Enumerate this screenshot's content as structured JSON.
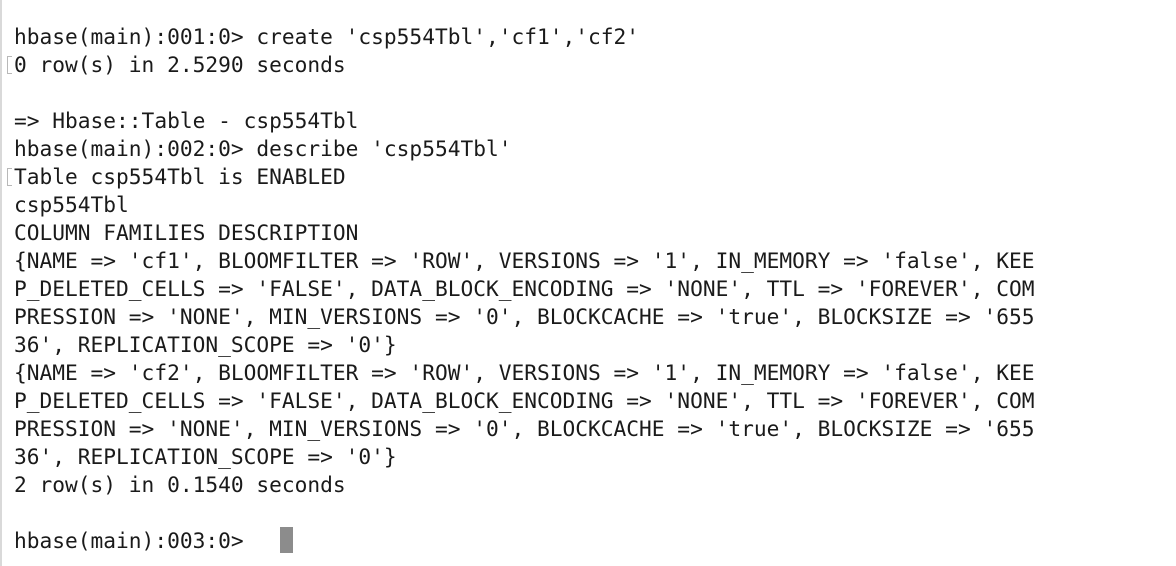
{
  "terminal": {
    "lines": [
      "hbase(main):001:0> create 'csp554Tbl','cf1','cf2'",
      "0 row(s) in 2.5290 seconds",
      "",
      "=> Hbase::Table - csp554Tbl",
      "hbase(main):002:0> describe 'csp554Tbl'",
      "Table csp554Tbl is ENABLED",
      "csp554Tbl",
      "COLUMN FAMILIES DESCRIPTION",
      "{NAME => 'cf1', BLOOMFILTER => 'ROW', VERSIONS => '1', IN_MEMORY => 'false', KEE",
      "P_DELETED_CELLS => 'FALSE', DATA_BLOCK_ENCODING => 'NONE', TTL => 'FOREVER', COM",
      "PRESSION => 'NONE', MIN_VERSIONS => '0', BLOCKCACHE => 'true', BLOCKSIZE => '655",
      "36', REPLICATION_SCOPE => '0'}",
      "{NAME => 'cf2', BLOOMFILTER => 'ROW', VERSIONS => '1', IN_MEMORY => 'false', KEE",
      "P_DELETED_CELLS => 'FALSE', DATA_BLOCK_ENCODING => 'NONE', TTL => 'FOREVER', COM",
      "PRESSION => 'NONE', MIN_VERSIONS => '0', BLOCKCACHE => 'true', BLOCKSIZE => '655",
      "36', REPLICATION_SCOPE => '0'}",
      "2 row(s) in 0.1540 seconds",
      "",
      "hbase(main):003:0> "
    ],
    "colors": {
      "background": "#ffffff",
      "text": "#1a1a1a",
      "cursor": "#8c8c8c"
    }
  }
}
